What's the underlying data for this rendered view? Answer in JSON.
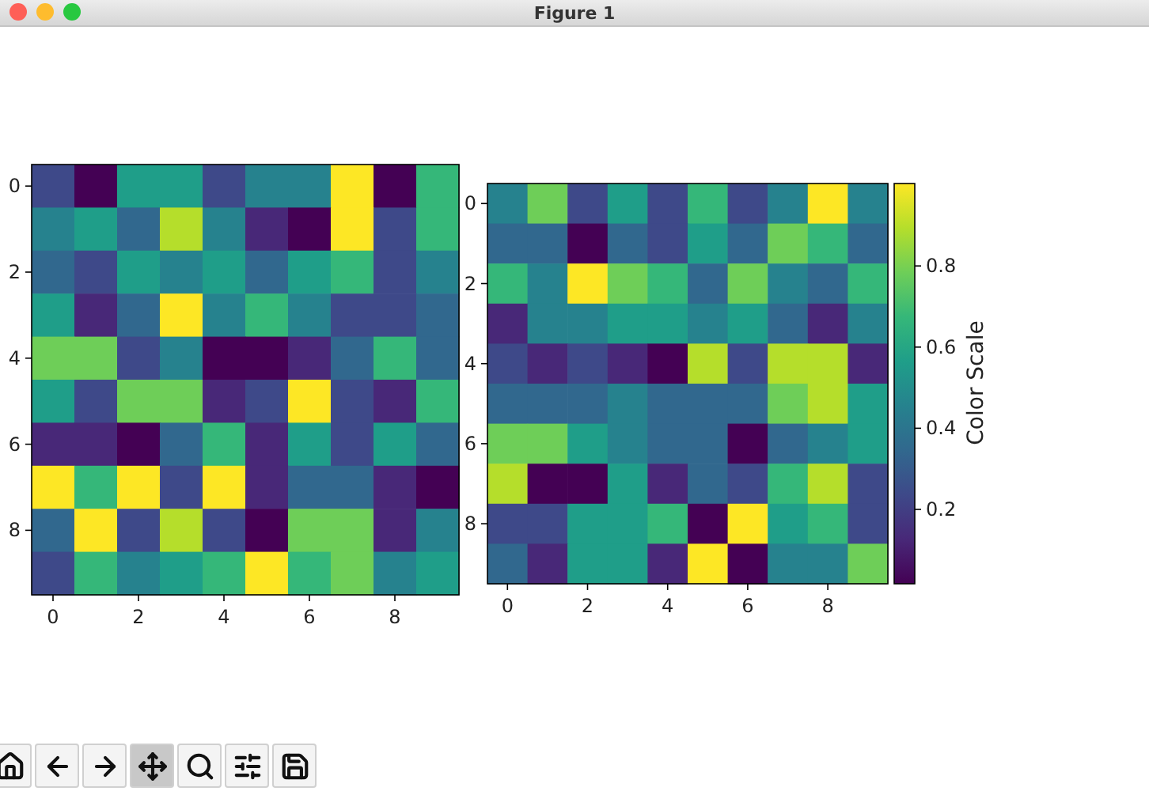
{
  "window": {
    "title": "Figure 1"
  },
  "plots": [
    {
      "xticks": [
        "0",
        "2",
        "4",
        "6",
        "8"
      ],
      "yticks": [
        "0",
        "2",
        "4",
        "6",
        "8"
      ]
    },
    {
      "xticks": [
        "0",
        "2",
        "4",
        "6",
        "8"
      ],
      "yticks": [
        "0",
        "2",
        "4",
        "6",
        "8"
      ],
      "colorbar": {
        "label": "Color Scale",
        "ticks": [
          "0.8",
          "0.6",
          "0.4",
          "0.2"
        ]
      }
    }
  ],
  "toolbar": [
    {
      "kind": "home",
      "selected": false
    },
    {
      "kind": "back",
      "selected": false
    },
    {
      "kind": "forward",
      "selected": false
    },
    {
      "kind": "pan",
      "selected": true
    },
    {
      "kind": "zoom",
      "selected": false
    },
    {
      "kind": "configure",
      "selected": false
    },
    {
      "kind": "save",
      "selected": false
    }
  ]
}
